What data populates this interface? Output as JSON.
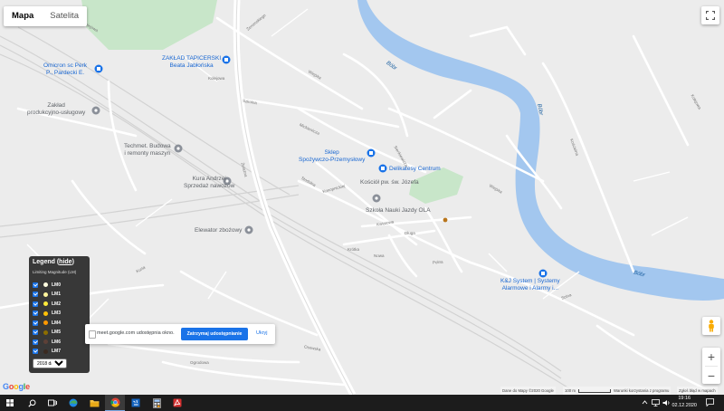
{
  "map": {
    "type_buttons": {
      "map": "Mapa",
      "satellite": "Satelita"
    },
    "pois": [
      {
        "name": "ZAKŁAD TAPICERSKI\nBeata Jabłońska",
        "color": "blue"
      },
      {
        "name": "Omicron sc Perk\nP., Pardecki E.",
        "color": "blue"
      },
      {
        "name": "Zakład\nprodukcyjno-usługowy",
        "color": "gray"
      },
      {
        "name": "Techmet. Budowa\ni remonty maszyn",
        "color": "gray"
      },
      {
        "name": "Kura Andrzej\nSprzedaż nawozów",
        "color": "gray"
      },
      {
        "name": "Elewator zbożowy",
        "color": "gray"
      },
      {
        "name": "Sklep\nSpożywczo-Przemysłowy",
        "color": "blue"
      },
      {
        "name": "Delikatesy Centrum",
        "color": "blue"
      },
      {
        "name": "Kościół pw. św. Józefa",
        "color": "gray"
      },
      {
        "name": "Szkoła Nauki Jazdy OLA",
        "color": "gray"
      },
      {
        "name": "K&J System | Systemy\nAlarmowe i Alarmy i...",
        "color": "blue"
      }
    ],
    "streets": [
      "Kolejowa",
      "Żeromskiego",
      "Kolejowa",
      "Szkolna",
      "Wiejska",
      "Żelazna",
      "Mickiewicza",
      "Sienkiewicza",
      "Konopnickiej",
      "Stodolna",
      "Kwiatowa",
      "Polna",
      "Długa",
      "Krótka",
      "Osowska",
      "Wiejska",
      "Nowa",
      "Ogrodowa",
      "Kościelna",
      "Kurta",
      "Solna",
      "Kolejowa"
    ],
    "river": [
      "Bóbr",
      "Bóbr",
      "Bóbr"
    ],
    "attribution": {
      "data": "Dane do Mapy ©2020 Google",
      "scale": "100 m",
      "terms": "Warunki korzystania z programu",
      "report": "Zgłoś błąd w mapach"
    },
    "google_logo": "Google",
    "colors": {
      "river": "#a3c7ef",
      "park": "#c8e6c9",
      "road": "#ffffff",
      "land": "#ececec"
    }
  },
  "legend": {
    "title": "Legend",
    "hide_link": "hide",
    "subtitle": "Limiting Magnitude (LM)",
    "items": [
      {
        "label": "LM0",
        "color": "#fffde0"
      },
      {
        "label": "LM1",
        "color": "#fff59d"
      },
      {
        "label": "LM2",
        "color": "#ffeb3b"
      },
      {
        "label": "LM3",
        "color": "#ffc107"
      },
      {
        "label": "LM4",
        "color": "#ff9800"
      },
      {
        "label": "LM5",
        "color": "#8d6e00"
      },
      {
        "label": "LM6",
        "color": "#5d4037"
      },
      {
        "label": "LM7",
        "color": "#3b2a20"
      }
    ],
    "select_value": "2018 data"
  },
  "share_bar": {
    "message": "meet.google.com udostępnia okno.",
    "stop_button": "Zatrzymaj udostępnianie",
    "hide_button": "Ukryj"
  },
  "taskbar": {
    "time": "19:16",
    "date": "02.12.2020"
  }
}
